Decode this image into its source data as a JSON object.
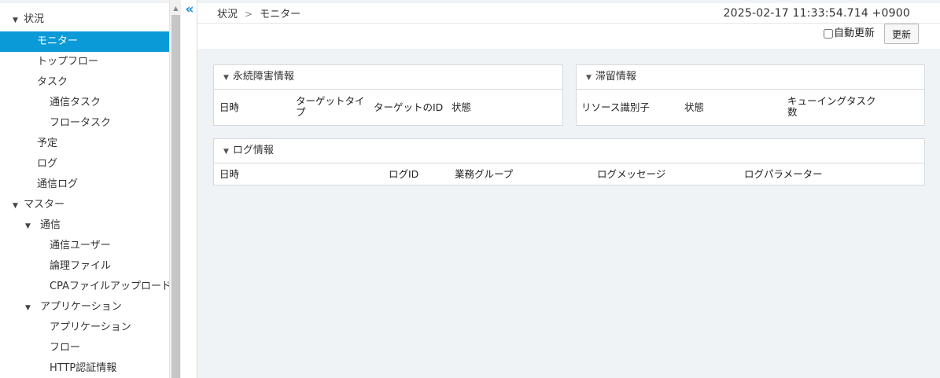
{
  "sidebar": {
    "items": [
      {
        "label": "状況",
        "caret": "▼"
      },
      {
        "label": "モニター"
      },
      {
        "label": "トップフロー"
      },
      {
        "label": "タスク"
      },
      {
        "label": "通信タスク"
      },
      {
        "label": "フロータスク"
      },
      {
        "label": "予定"
      },
      {
        "label": "ログ"
      },
      {
        "label": "通信ログ"
      },
      {
        "label": "マスター",
        "caret": "▼"
      },
      {
        "label": "通信",
        "caret": "▼"
      },
      {
        "label": "通信ユーザー"
      },
      {
        "label": "論理ファイル"
      },
      {
        "label": "CPAファイルアップロード"
      },
      {
        "label": "アプリケーション",
        "caret": "▼"
      },
      {
        "label": "アプリケーション"
      },
      {
        "label": "フロー"
      },
      {
        "label": "HTTP認証情報"
      }
    ],
    "collapse_icon": "«",
    "scroll_up_icon": "▲"
  },
  "header": {
    "breadcrumb": [
      "状況",
      "モニター"
    ],
    "breadcrumb_sep": ">",
    "timestamp": "2025-02-17 11:33:54.714 +0900",
    "auto_refresh_label": "自動更新",
    "refresh_button": "更新"
  },
  "panels": {
    "persistent_error": {
      "title": "永続障害情報",
      "columns": [
        "日時",
        "ターゲットタイプ",
        "ターゲットのID",
        "状態"
      ]
    },
    "stagnation": {
      "title": "滞留情報",
      "columns": [
        "リソース識別子",
        "状態",
        "キューイングタスク数"
      ]
    },
    "log": {
      "title": "ログ情報",
      "columns": [
        "日時",
        "ログID",
        "業務グループ",
        "ログメッセージ",
        "ログパラメーター"
      ]
    }
  }
}
